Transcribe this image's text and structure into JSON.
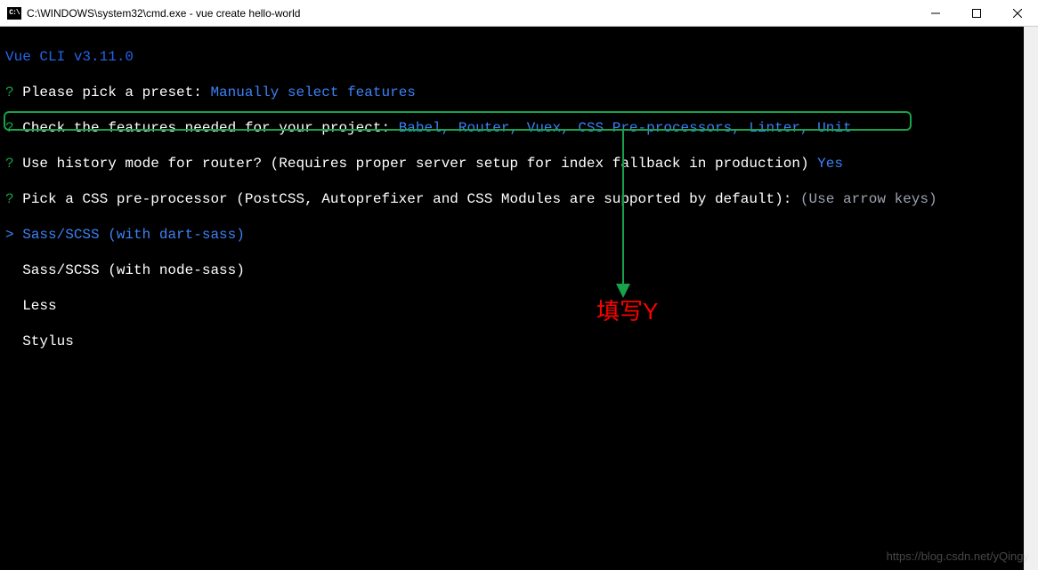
{
  "window": {
    "title": "C:\\WINDOWS\\system32\\cmd.exe - vue  create hello-world",
    "icon_label": "cmd-icon"
  },
  "cli": {
    "header": "Vue CLI v3.11.0",
    "q_mark": "?",
    "prompt_mark": ">",
    "line1": {
      "question": " Please pick a preset: ",
      "answer": "Manually select features"
    },
    "line2": {
      "question": " Check the features needed for your project: ",
      "answer": "Babel, Router, Vuex, CSS Pre-processors, Linter, Unit"
    },
    "line3": {
      "question": " Use history mode for router? (Requires proper server setup for index fallback in production) ",
      "answer": "Yes"
    },
    "line4": {
      "question": " Pick a CSS pre-processor (PostCSS, Autoprefixer and CSS Modules are supported by default): ",
      "hint": "(Use arrow keys)"
    },
    "options": {
      "opt1": " Sass/SCSS (with dart-sass)",
      "opt2": "  Sass/SCSS (with node-sass)",
      "opt3": "  Less",
      "opt4": "  Stylus"
    }
  },
  "annotation": {
    "text": "填写Y"
  },
  "watermark": "https://blog.csdn.net/yQingy"
}
